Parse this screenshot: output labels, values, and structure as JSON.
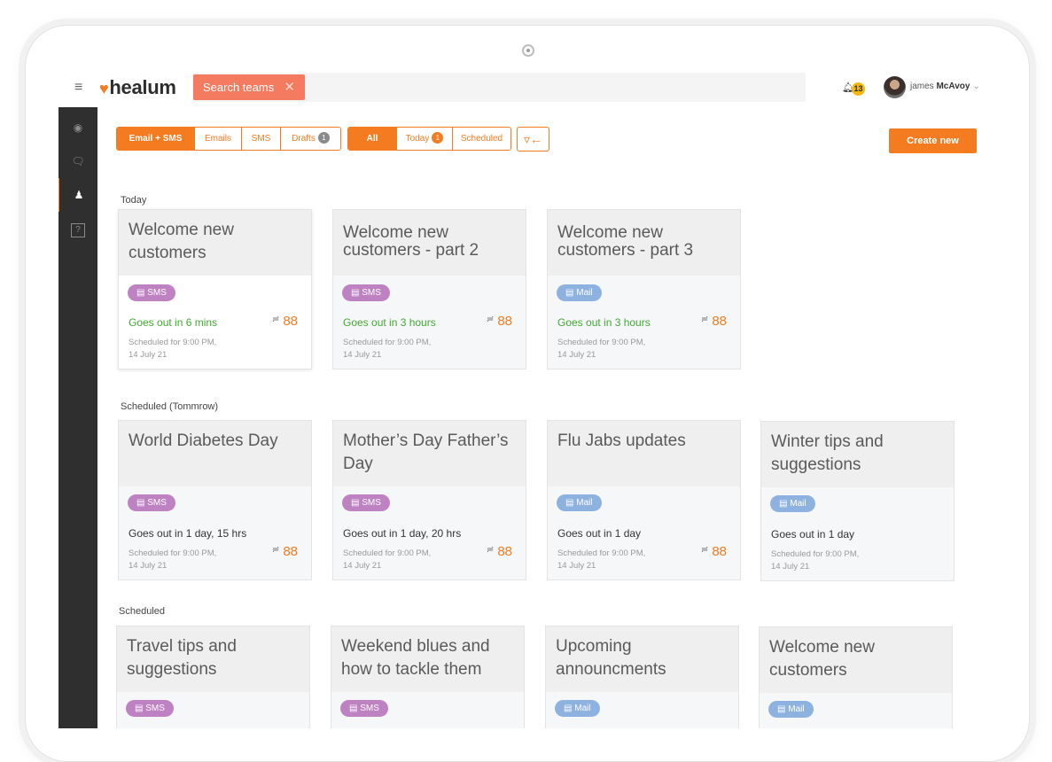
{
  "app": {
    "logo_text": "healum",
    "search_chip": "Search teams",
    "notification_count": "13",
    "user": {
      "first": "james",
      "last": "McAvoy"
    }
  },
  "icons": {
    "menu": "hamburger-icon",
    "logo": "heart-icon",
    "notification": "bell-icon",
    "filter": "funnel-icon",
    "sidebar": [
      "dashboard-icon",
      "chat-icon",
      "user-icon",
      "help-icon"
    ]
  },
  "colors": {
    "accent": "#f47b20",
    "sms": "#be82c2",
    "mail": "#8eb2e0",
    "success": "#42a833"
  },
  "filters": {
    "channel_tabs": [
      {
        "label": "Email + SMS",
        "active": true
      },
      {
        "label": "Emails"
      },
      {
        "label": "SMS"
      },
      {
        "label": "Drafts",
        "count": "1"
      }
    ],
    "time_tabs": [
      {
        "label": "All",
        "active": true
      },
      {
        "label": "Today",
        "count": "1"
      },
      {
        "label": "Scheduled"
      }
    ]
  },
  "create_label": "Create new",
  "sections": [
    {
      "label": "Today",
      "cards": [
        {
          "title": "Welcome new customers",
          "type": "SMS",
          "status": "Goes out in 6 mins",
          "scheduled_line1": "Scheduled for 9:00 PM,",
          "scheduled_line2": "14 July 21",
          "recipients": "88"
        },
        {
          "title": "Welcome new customers - part 2",
          "type": "SMS",
          "status": "Goes out in 3 hours",
          "scheduled_line1": "Scheduled for 9:00 PM,",
          "scheduled_line2": "14 July 21",
          "recipients": "88"
        },
        {
          "title": "Welcome new customers - part 3",
          "type": "Mail",
          "status": "Goes out in 3 hours",
          "scheduled_line1": "Scheduled for 9:00 PM,",
          "scheduled_line2": "14 July 21",
          "recipients": "88"
        }
      ]
    },
    {
      "label": "Scheduled (Tommrow)",
      "cards": [
        {
          "title": "World Diabetes Day",
          "type": "SMS",
          "status": "Goes out in 1 day, 15 hrs",
          "scheduled_line1": "Scheduled for 9:00 PM,",
          "scheduled_line2": "14 July 21",
          "recipients": "88"
        },
        {
          "title": "Mother’s Day Father’s Day",
          "type": "SMS",
          "status": "Goes out in 1 day, 20 hrs",
          "scheduled_line1": "Scheduled for 9:00 PM,",
          "scheduled_line2": "14 July 21",
          "recipients": "88"
        },
        {
          "title": "Flu Jabs updates",
          "type": "Mail",
          "status": "Goes out in 1 day",
          "scheduled_line1": "Scheduled for 9:00 PM,",
          "scheduled_line2": "14 July 21",
          "recipients": "88"
        },
        {
          "title": "Winter tips and suggestions",
          "type": "Mail",
          "status": "Goes out in 1 day",
          "scheduled_line1": "Scheduled for 9:00 PM,",
          "scheduled_line2": "14 July 21"
        }
      ]
    },
    {
      "label": "Scheduled",
      "cards": [
        {
          "title": "Travel tips and suggestions",
          "type": "SMS"
        },
        {
          "title": "Weekend blues and how to tackle them",
          "type": "SMS"
        },
        {
          "title": "Upcoming announcments",
          "type": "Mail"
        },
        {
          "title": "Welcome new customers",
          "type": "Mail"
        }
      ]
    }
  ]
}
